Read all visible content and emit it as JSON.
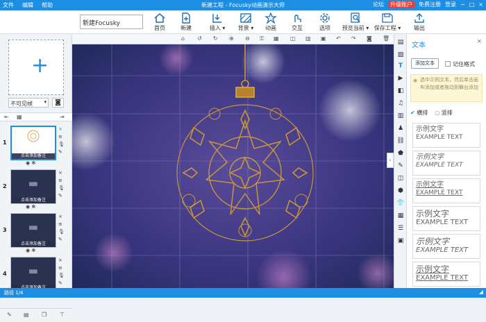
{
  "titlebar": {
    "menu": [
      "文件",
      "编辑",
      "帮助"
    ],
    "title": "新建工程 - Focusky动画演示大师",
    "links": {
      "forum": "论坛",
      "upgrade": "升级账户",
      "register": "免费注册",
      "login": "登录"
    },
    "window_controls": [
      "−",
      "□",
      "×"
    ]
  },
  "toolbar": {
    "project_name": "新建Focusky",
    "buttons": [
      {
        "label": "首页",
        "icon": "home-icon"
      },
      {
        "label": "新建",
        "icon": "new-file-icon"
      },
      {
        "label": "插入",
        "icon": "insert-icon"
      },
      {
        "label": "背景",
        "icon": "background-icon"
      },
      {
        "label": "动画",
        "icon": "animation-icon"
      },
      {
        "label": "交互",
        "icon": "interaction-icon"
      },
      {
        "label": "选项",
        "icon": "gear-icon"
      },
      {
        "label": "预览当前",
        "icon": "preview-icon"
      },
      {
        "label": "保存工程",
        "icon": "save-icon"
      },
      {
        "label": "输出",
        "icon": "export-icon"
      }
    ]
  },
  "left_panel": {
    "add_frame_symbol": "+",
    "visibility_value": "不可见帧",
    "visibility_arrow": "▾",
    "camera_icon_glyph": "◙",
    "slides": [
      {
        "num": "1",
        "label": "点击添加备注",
        "tag": "",
        "active": true
      },
      {
        "num": "2",
        "label": "点击添加备注",
        "tag": "▒▒▒",
        "active": false
      },
      {
        "num": "3",
        "label": "点击添加备注",
        "tag": "▒▒▒",
        "active": false
      },
      {
        "num": "4",
        "label": "点击添加备注",
        "tag": "▒▒▒",
        "active": false
      }
    ],
    "slide_controls": "◉ ✻",
    "slide_side_icons": [
      "×",
      "≡",
      "🎙",
      "✎"
    ]
  },
  "canvas": {
    "background": "#34327a",
    "ornament_color": "#c9953a"
  },
  "right_panel": {
    "title": "文本",
    "close": "×",
    "add_text_label": "添加文本",
    "remember_label": "记住格式",
    "hint": "选中示例文本，然后单击画布添加或者拖动到舞台添加",
    "orient_horizontal": "横排",
    "orient_vertical": "竖排",
    "samples": [
      {
        "zh": "示例文字",
        "en": "EXAMPLE TEXT"
      },
      {
        "zh": "示例文字",
        "en": "EXAMPLE TEXT"
      },
      {
        "zh": "示例文字",
        "en": "EXAMPLE TEXT"
      },
      {
        "zh": "示例文字",
        "en": "EXAMPLE TEXT"
      },
      {
        "zh": "示例文字",
        "en": "EXAMPLE TEXT"
      },
      {
        "zh": "示例文字",
        "en": "EXAMPLE TEXT"
      }
    ]
  },
  "statusbar": {
    "path": "路径 1/4"
  }
}
